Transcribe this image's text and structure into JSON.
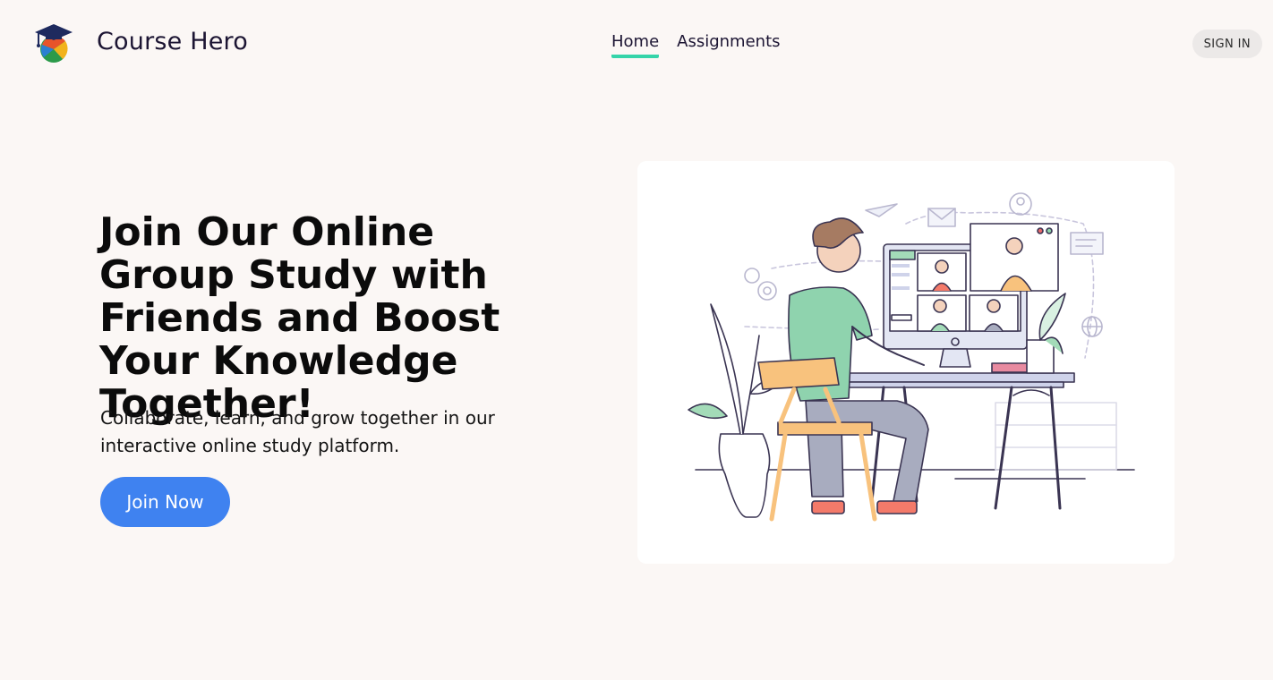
{
  "brand": {
    "name": "Course Hero",
    "logo_icon": "graduation-cap-logo-icon"
  },
  "nav": {
    "items": [
      {
        "label": "Home",
        "active": true
      },
      {
        "label": "Assignments",
        "active": false
      }
    ]
  },
  "header": {
    "signin_label": "SIGN IN"
  },
  "hero": {
    "title": "Join Our Online Group Study with Friends and Boost Your Knowledge Together!",
    "subtitle": "Collaborate, learn, and grow together in our interactive online study platform.",
    "cta_label": "Join Now"
  },
  "illustration": {
    "icon": "online-study-illustration"
  },
  "colors": {
    "background": "#fbf7f5",
    "nav_active_underline": "#35d4a9",
    "cta": "#3f82f0",
    "text": "#1c1533"
  }
}
